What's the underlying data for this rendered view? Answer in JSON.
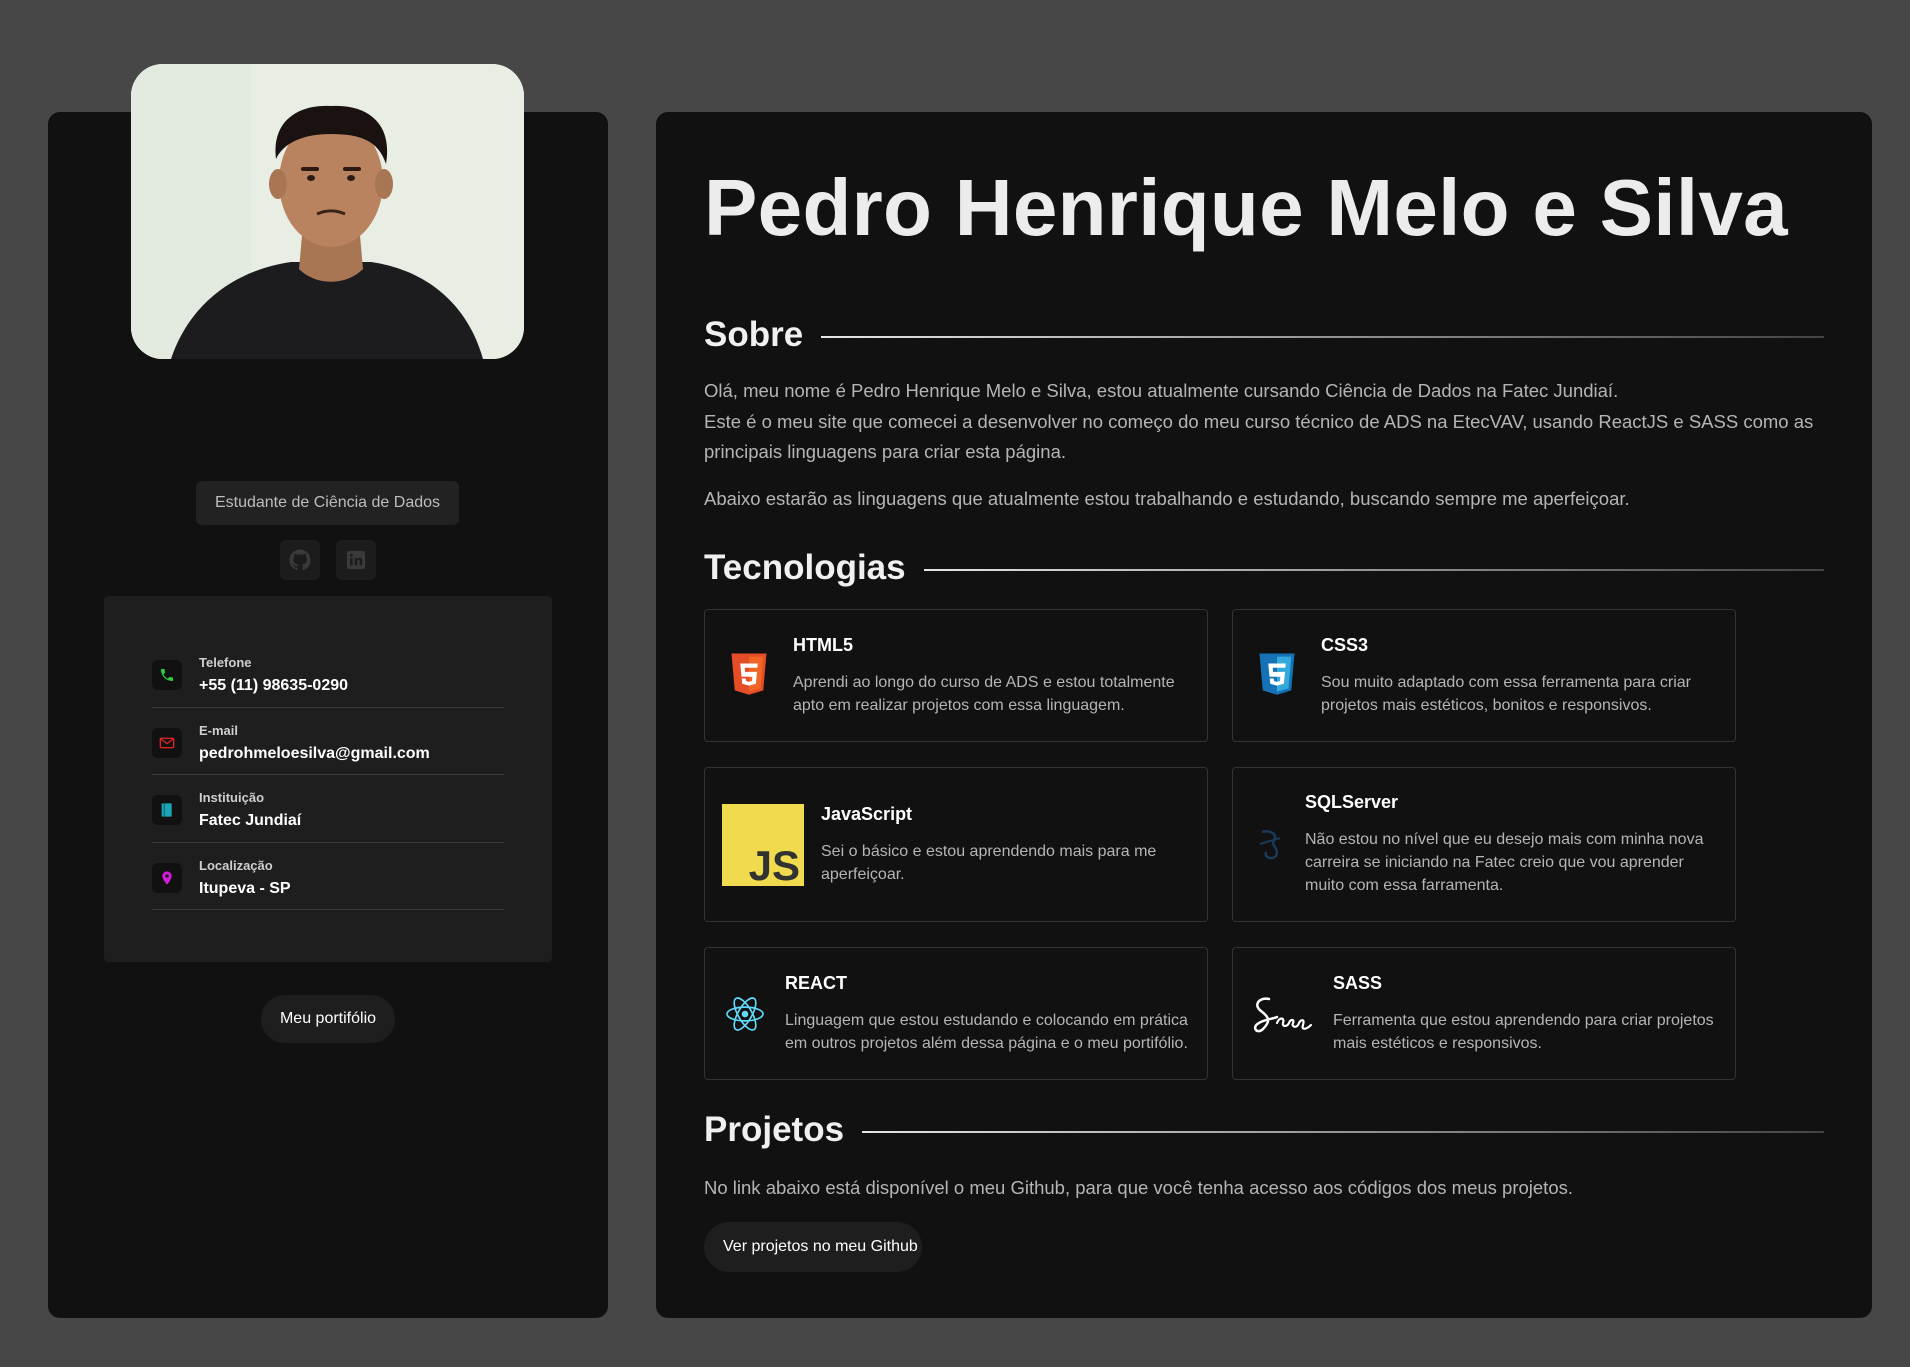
{
  "profile": {
    "role": "Estudante de Ciência de Dados",
    "socials": [
      {
        "name": "github-icon"
      },
      {
        "name": "linkedin-icon"
      }
    ],
    "contacts": [
      {
        "label": "Telefone",
        "value": "+55 (11) 98635-0290",
        "icon": "phone-icon",
        "color": "#2ecc40"
      },
      {
        "label": "E-mail",
        "value": "pedrohmeloesilva@gmail.com",
        "icon": "mail-icon",
        "color": "#e02424"
      },
      {
        "label": "Instituição",
        "value": "Fatec Jundiaí",
        "icon": "book-icon",
        "color": "#1aa6b7"
      },
      {
        "label": "Localização",
        "value": "Itupeva - SP",
        "icon": "location-icon",
        "color": "#d21dd8"
      }
    ],
    "portfolio_button": "Meu portifólio"
  },
  "main": {
    "name": "Pedro Henrique Melo e Silva",
    "about": {
      "title": "Sobre",
      "p1_line1": "Olá, meu nome é Pedro Henrique Melo e Silva, estou atualmente cursando Ciência de Dados na Fatec Jundiaí.",
      "p1_line2": "Este é o meu site que comecei a desenvolver no começo do meu curso técnico de ADS na EtecVAV, usando ReactJS e SASS como as principais linguagens para criar esta página.",
      "p2": "Abaixo estarão as linguagens que atualmente estou trabalhando e estudando, buscando sempre me aperfeiçoar."
    },
    "tech": {
      "title": "Tecnologias",
      "cards": [
        {
          "title": "HTML5",
          "desc": "Aprendi ao longo do curso de ADS e estou totalmente apto em realizar projetos com essa linguagem.",
          "icon": "html5-icon"
        },
        {
          "title": "CSS3",
          "desc": "Sou muito adaptado com essa ferramenta para criar projetos mais estéticos, bonitos e responsivos.",
          "icon": "css3-icon"
        },
        {
          "title": "JavaScript",
          "desc": "Sei o básico e estou aprendendo mais para me aperfeiçoar.",
          "icon": "javascript-icon"
        },
        {
          "title": "SQLServer",
          "desc": "Não estou no nível que eu desejo mais com minha nova carreira se iniciando na Fatec creio que vou aprender muito com essa farramenta.",
          "icon": "sqlserver-icon"
        },
        {
          "title": "REACT",
          "desc": "Linguagem que estou estudando e colocando em prática em outros projetos além dessa página e o meu portifólio.",
          "icon": "react-icon"
        },
        {
          "title": "SASS",
          "desc": "Ferramenta que estou aprendendo para criar projetos mais estéticos e responsivos.",
          "icon": "sass-icon"
        }
      ]
    },
    "projects": {
      "title": "Projetos",
      "desc": "No link abaixo está disponível o meu Github, para que você tenha acesso aos códigos dos meus projetos.",
      "button": "Ver projetos no meu Github"
    }
  }
}
